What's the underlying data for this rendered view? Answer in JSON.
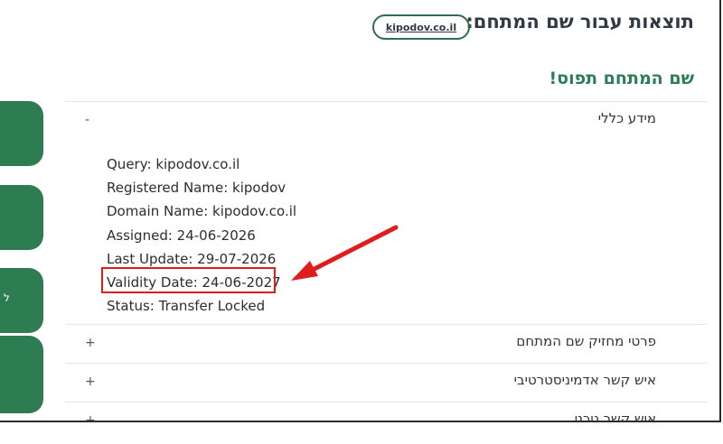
{
  "header": {
    "title": "תוצאות עבור שם המתחם:",
    "domain_pill": "kipodov.co.il"
  },
  "status_heading": "שם המתחם תפוס!",
  "side_tabs": [
    {
      "label": ""
    },
    {
      "label": ""
    },
    {
      "label": "ל"
    },
    {
      "label": ""
    }
  ],
  "accordion": {
    "general": {
      "title": "מידע כללי",
      "toggle": "-",
      "fields": [
        "Query: kipodov.co.il",
        "Registered Name: kipodov",
        "Domain Name: kipodov.co.il",
        "Assigned: 24-06-2026",
        "Last Update: 29-07-2026",
        "Validity Date: 24-06-2027",
        "Status: Transfer Locked"
      ]
    },
    "holder": {
      "title": "פרטי מחזיק שם המתחם",
      "toggle": "+"
    },
    "admin": {
      "title": "איש קשר אדמיניסטרטיבי",
      "toggle": "+"
    },
    "tech": {
      "title": "איש קשר טכני",
      "toggle": "+"
    }
  },
  "annotation": {
    "box_color": "#e01c1c",
    "arrow_color": "#e01c1c"
  },
  "colors": {
    "brand_green": "#2e7d52",
    "heading_green": "#2a7d54",
    "title_dark": "#2f3a44"
  }
}
